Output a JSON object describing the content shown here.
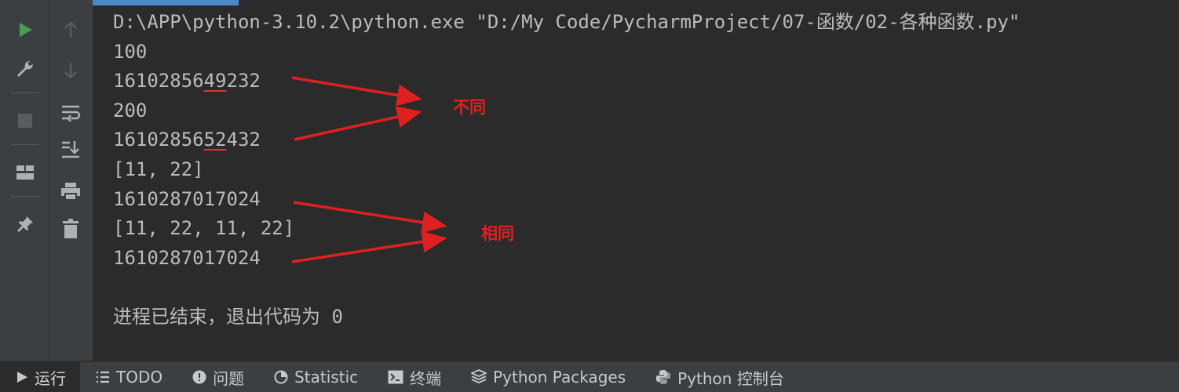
{
  "console": {
    "lines": [
      "D:\\APP\\python-3.10.2\\python.exe \"D:/My Code/PycharmProject/07-函数/02-各种函数.py\"",
      "100",
      "1610285649232",
      "200",
      "1610285652432",
      "[11, 22]",
      "1610287017024",
      "[11, 22, 11, 22]",
      "1610287017024",
      "",
      "进程已结束，退出代码为 0"
    ]
  },
  "annotations": {
    "different": "不同",
    "same": "相同"
  },
  "gutter": {
    "left_icons": [
      "run-icon",
      "wrench-icon",
      "stop-icon",
      "layout-icon",
      "pin-icon"
    ],
    "right_icons": [
      "up-arrow-icon",
      "down-arrow-icon",
      "soft-wrap-icon",
      "scroll-to-end-icon",
      "print-icon",
      "trash-icon"
    ]
  },
  "bottom_tabs": [
    {
      "label": "运行",
      "icon": "run-icon",
      "active": true
    },
    {
      "label": "TODO",
      "icon": "list-icon"
    },
    {
      "label": "问题",
      "icon": "problems-icon"
    },
    {
      "label": "Statistic",
      "icon": "statistic-icon"
    },
    {
      "label": "终端",
      "icon": "terminal-icon"
    },
    {
      "label": "Python Packages",
      "icon": "packages-icon"
    },
    {
      "label": "Python 控制台",
      "icon": "python-icon"
    }
  ],
  "colors": {
    "background": "#2b2b2b",
    "panel": "#3c3f41",
    "text": "#bbbbbb",
    "annotation_red": "#e02020",
    "run_green": "#499c54",
    "tab_indicator": "#4a88c7"
  }
}
